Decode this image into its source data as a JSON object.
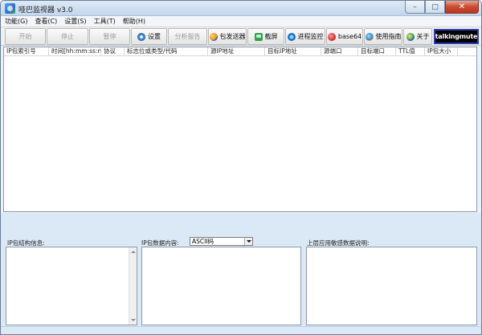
{
  "window": {
    "title": "哑巴监视器 v3.0"
  },
  "menu": [
    "功能(G)",
    "查看(C)",
    "设置(S)",
    "工具(T)",
    "帮助(H)"
  ],
  "toolbar": {
    "start": "开始",
    "stop": "停止",
    "pause": "暂停",
    "settings": "设置",
    "report": "分析报告",
    "sender": "包发送器",
    "screenshot": "截屏",
    "process": "进程监控",
    "base64": "base64",
    "guide": "使用指南",
    "about": "关于",
    "logo": "talkingmute"
  },
  "columns": [
    "IP包索引号",
    "时间[hh:mm:ss:ms]",
    "协议",
    "标志位或类型/代码",
    "源IP地址",
    "目标IP地址",
    "源端口",
    "目标端口",
    "TTL值",
    "IP包大小"
  ],
  "panels": {
    "structure_label": "IP包结构信息:",
    "content_label": "IP包数据内容:",
    "encoding_value": "ASCII码",
    "sensitive_label": "上层应用敏感数据说明:"
  }
}
